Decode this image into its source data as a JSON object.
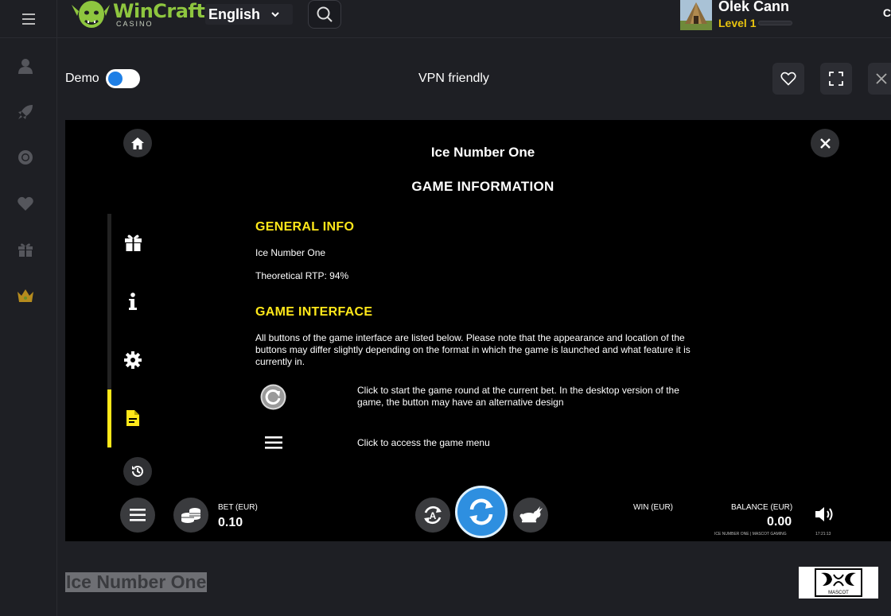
{
  "header": {
    "brand_name": "WinCraft",
    "brand_sub": "CASINO",
    "language": "English",
    "user_name": "Olek Cann",
    "user_level": "Level 1",
    "trailing_char": "C"
  },
  "game_header": {
    "demo_label": "Demo",
    "demo_enabled": true,
    "vpn_text": "VPN friendly"
  },
  "game": {
    "title": "Ice Number One",
    "section_title": "GAME INFORMATION",
    "general_info": {
      "heading": "GENERAL INFO",
      "game_name": "Ice Number One",
      "rtp": "Theoretical RTP: 94%"
    },
    "game_interface": {
      "heading": "GAME INTERFACE",
      "intro": "All buttons of the game interface are listed below. Please note that the appearance and location of the buttons may differ slightly depending on the format in which the game is launched and what feature it is currently in.",
      "items": [
        {
          "icon": "spin-icon",
          "text": "Click to start the game round at the current bet. In the desktop version of the game, the button may have an alternative design"
        },
        {
          "icon": "menu-icon",
          "text": "Click to access the game menu"
        }
      ]
    },
    "bottom_bar": {
      "bet_label": "BET (EUR)",
      "bet_value": "0.10",
      "win_label": "WIN (EUR)",
      "balance_label": "BALANCE (EUR)",
      "balance_value": "0.00",
      "footer_text": "ICE NUMBER ONE | MASCOT GAMING",
      "clock": "17:21:13"
    }
  },
  "caption": "Ice Number One",
  "provider_logo": "MASCOT",
  "colors": {
    "accent_yellow": "#ffe81a",
    "brand_green": "#8ec63f",
    "level_gold": "#e8c30f",
    "toggle_blue": "#1e7fe6",
    "spin_blue": "#2e8fe0"
  }
}
